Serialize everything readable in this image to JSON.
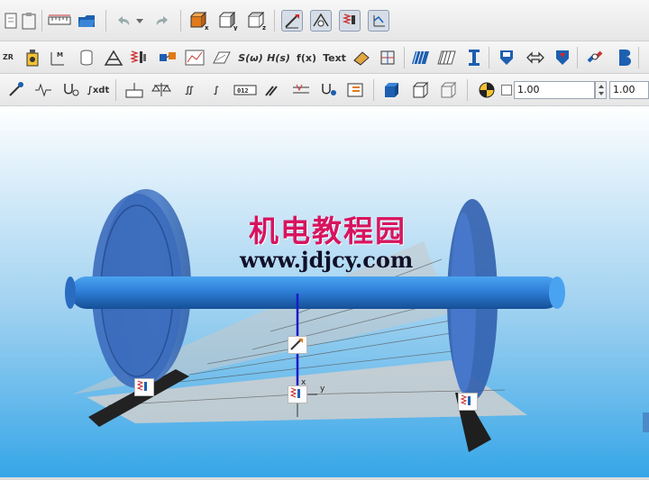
{
  "toolbar": {
    "row2_labels": {
      "s_omega": "S(ω)",
      "h_s": "H(s)",
      "f_x": "f(x)",
      "text": "Text"
    },
    "row3_labels": {
      "integrate_label": "∫xdt"
    },
    "scale_field_1": "1.00",
    "scale_field_2": "1.00"
  },
  "viewport": {
    "watermark_cn": "机电教程园",
    "watermark_url": "www.jdjcy.com",
    "axis_y": "y",
    "axis_x": "x",
    "wheel_color": "#3a6fc4",
    "axle_color": "#2f7fd8",
    "rail_color": "#222222"
  },
  "icons": {
    "row1": [
      "document-icon",
      "clipboard-icon",
      "ruler-icon",
      "folder-icon",
      "undo-icon",
      "dropdown-icon",
      "redo-icon",
      "view-x-icon",
      "view-y-icon",
      "view-z-icon",
      "select-mode-icon",
      "joint-view-icon",
      "spring-view-icon",
      "axis-view-icon"
    ],
    "row2": [
      "body-icon",
      "mass-icon",
      "moment-icon",
      "cylinder-icon",
      "truss-icon",
      "spring-icon",
      "connector-icon",
      "curve-icon",
      "surface-icon",
      "s-omega-icon",
      "h-s-icon",
      "f-x-icon",
      "text-icon",
      "eraser-icon",
      "cube-grid-icon",
      "hatch-icon",
      "stripe-icon",
      "beam-icon",
      "load-icon",
      "link-icon",
      "force-icon",
      "chain-icon",
      "b-icon"
    ]
  }
}
